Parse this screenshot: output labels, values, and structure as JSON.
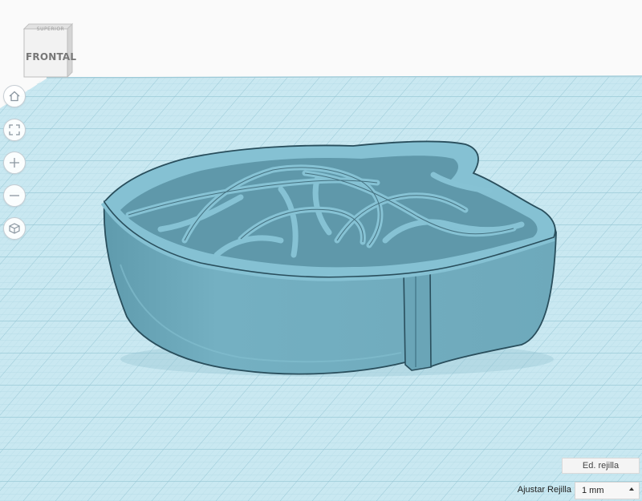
{
  "view_cube": {
    "top_label": "SUPERIOR",
    "front_label": "FRONTAL"
  },
  "nav_controls": [
    {
      "name": "home-view-button",
      "icon": "home-icon"
    },
    {
      "name": "fit-view-button",
      "icon": "fit-view-icon"
    },
    {
      "name": "zoom-in-button",
      "icon": "plus-icon"
    },
    {
      "name": "zoom-out-button",
      "icon": "minus-icon"
    },
    {
      "name": "perspective-button",
      "icon": "cube-icon"
    }
  ],
  "grid_controls": {
    "edit_grid_label": "Ed. rejilla",
    "snap_label": "Ajustar Rejilla",
    "snap_value": "1 mm"
  },
  "colors": {
    "workplane": "#c6e6ef",
    "grid_line": "#99c8d6",
    "model": "#7db9cb",
    "model_dark": "#5d97a9",
    "outline": "#294e5c"
  }
}
